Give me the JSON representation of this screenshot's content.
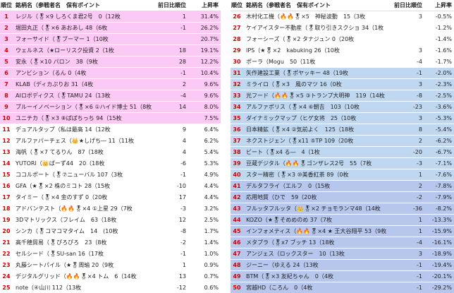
{
  "headers": {
    "rank": "順位",
    "name": "銘柄名（参戦者名　保有ポイント",
    "prev": "前日比順位",
    "rate": "上昇率"
  },
  "left_rows": [
    {
      "rank": "1",
      "name": "レジル（🎖×9 しろくま君2号　0（12枚",
      "prev": "1",
      "rate": "31.4%",
      "bg": "pink"
    },
    {
      "rank": "2",
      "name": "堀田丸正（🎖×6 あおあし 48（6枚",
      "prev": "-1",
      "rate": "26.2%",
      "bg": "pink"
    },
    {
      "rank": "3",
      "name": "フォーサイド（🎖ブーマー 1（10枚",
      "prev": "",
      "rate": "20.7%",
      "bg": "pink"
    },
    {
      "rank": "4",
      "name": "ウェルネス（★ローリスク投資 2（1枚",
      "prev": "18",
      "rate": "19.1%",
      "bg": "pink"
    },
    {
      "rank": "5",
      "name": "安永（🎖×10 パロン　38（9枚",
      "prev": "28",
      "rate": "12.2%",
      "bg": "pink"
    },
    {
      "rank": "6",
      "name": "アンビション（るん 0（4枚",
      "prev": "-1",
      "rate": "10.4%",
      "bg": "pink"
    },
    {
      "rank": "7",
      "name": "KLAB（ディカぷりお 31（4枚",
      "prev": "2",
      "rate": "9.6%",
      "bg": "pink"
    },
    {
      "rank": "8",
      "name": "AIロボディクス（🎖TAMU 24（13枚",
      "prev": "-4",
      "rate": "9.6%",
      "bg": "pink"
    },
    {
      "rank": "9",
      "name": "ブルーイノベーション（🎖×6 ①ハイド博士 51（8枚",
      "prev": "14",
      "rate": "8.0%",
      "bg": "pink"
    },
    {
      "rank": "10",
      "name": "ユニチカ（🎖×3 ⑧ぱぱちっち 94（15枚",
      "prev": "",
      "rate": "7.5%",
      "bg": "pink"
    },
    {
      "rank": "11",
      "name": "デュアルタップ（私は最高 14（12枚",
      "prev": "9",
      "rate": "6.4%",
      "bg": "white"
    },
    {
      "rank": "12",
      "name": "アルファパーチェス（👑★しげち― 11（11枚",
      "prev": "4",
      "rate": "6.2%",
      "bg": "white"
    },
    {
      "rank": "13",
      "name": "海帆（🎖×7 てるりん　87（18枚",
      "prev": "4",
      "rate": "5.4%",
      "bg": "white"
    },
    {
      "rank": "14",
      "name": "YUTORI（👑ぱーず44　20（18枚",
      "prev": "-6",
      "rate": "5.3%",
      "bg": "white"
    },
    {
      "rank": "15",
      "name": "ココルポート（🎖⑦ニューバル 107（3枚",
      "prev": "-1",
      "rate": "4.9%",
      "bg": "white"
    },
    {
      "rank": "16",
      "name": "GFA（★🎖×2 株のミコト 28（15枚",
      "prev": "-10",
      "rate": "4.4%",
      "bg": "white"
    },
    {
      "rank": "17",
      "name": "タイミー（🎖×4 金のすず 0（20枚",
      "prev": "17",
      "rate": "4.4%",
      "bg": "white"
    },
    {
      "rank": "18",
      "name": "アドバンテスト（🔥🔥🎖×4 ①上星 29（7枚",
      "prev": "-3",
      "rate": "3.2%",
      "bg": "white"
    },
    {
      "rank": "19",
      "name": "3Dマトリックス（フレイム　63（18枚",
      "prev": "12",
      "rate": "2.5%",
      "bg": "white"
    },
    {
      "rank": "20",
      "name": "シンカ（🎖コマコマタイム　14　(10枚",
      "prev": "-8",
      "rate": "1.7%",
      "bg": "white"
    },
    {
      "rank": "21",
      "name": "高千穂貿易（🎖ぴろぴろ　23（8枚",
      "prev": "-2",
      "rate": "1.4%",
      "bg": "white"
    },
    {
      "rank": "22",
      "name": "セルシード（🎖SU-san 16（17枚",
      "prev": "-1",
      "rate": "1.0%",
      "bg": "white"
    },
    {
      "rank": "23",
      "name": "丸藤シートパイル（★🎖周瑜 20（9枚",
      "prev": "1",
      "rate": "0.9%",
      "bg": "white"
    },
    {
      "rank": "24",
      "name": "デジタルグリッド（🔥🔥🎖×4 トム　6（14枚",
      "prev": "13",
      "rate": "0.7%",
      "bg": "white"
    },
    {
      "rank": "25",
      "name": "note（④山川 112（13枚",
      "prev": "-12",
      "rate": "0.6%",
      "bg": "white"
    }
  ],
  "right_rows": [
    {
      "rank": "26",
      "name": "木村化工機（🔥🔥🎖×5　神秘波動　15（3枚",
      "prev": "3",
      "rate": "-0.5%",
      "bg": "white"
    },
    {
      "rank": "27",
      "name": "ケイアイスター不動産（🎖取り引きスクショ 34（1枚",
      "prev": "",
      "rate": "-1.2%",
      "bg": "white"
    },
    {
      "rank": "28",
      "name": "フォーシーズ（🎖×2 タナジュン 0（20枚",
      "prev": "",
      "rate": "-1.4%",
      "bg": "white"
    },
    {
      "rank": "29",
      "name": "IPS（★🎖×2　kabuking 26（10枚",
      "prev": "3",
      "rate": "-1.6%",
      "bg": "white"
    },
    {
      "rank": "30",
      "name": "ポーラ（Mogu　50（11枚",
      "prev": "-4",
      "rate": "-1.7%",
      "bg": "white"
    },
    {
      "rank": "31",
      "name": "矢作建設工業（🎖ポヤッキー 48（19枚",
      "prev": "-1",
      "rate": "-2.0%",
      "bg": "blue"
    },
    {
      "rank": "32",
      "name": "ミライロ（🎖×3　風のマツ 16（0枚",
      "prev": "3",
      "rate": "-2.3%",
      "bg": "blue"
    },
    {
      "rank": "33",
      "name": "光フード（🔥🔥🎖×5 ③トランプ大明神　119（14枚",
      "prev": "-8",
      "rate": "-2.5%",
      "bg": "blue"
    },
    {
      "rank": "34",
      "name": "アルファポリス（🎖×4 ⑥朝吉　103（10枚",
      "prev": "-23",
      "rate": "-3.6%",
      "bg": "blue"
    },
    {
      "rank": "35",
      "name": "ダイナミックマップ（ヒゲ女将　25（10枚",
      "prev": "3",
      "rate": "-5.3%",
      "bg": "blue"
    },
    {
      "rank": "36",
      "name": "日本精鉱（🎖×4 ②気前よく　125（18枚",
      "prev": "8",
      "rate": "-5.4%",
      "bg": "blue"
    },
    {
      "rank": "37",
      "name": "ネクストジェン（🎖x11 ⑤TP 109（20枚",
      "prev": "2",
      "rate": "-6.2%",
      "bg": "blue"
    },
    {
      "rank": "38",
      "name": "ビート（🎖x4 る―　4（1枚",
      "prev": "-20",
      "rate": "-6.7%",
      "bg": "blue"
    },
    {
      "rank": "39",
      "name": "豆蔵デジタル（🔥🔥🎖ゴンザレス2号　55（7枚",
      "prev": "-3",
      "rate": "-7.1%",
      "bg": "blue"
    },
    {
      "rank": "40",
      "name": "スター精密（🎖×3 ⑩美香紅茶 89（0枚",
      "prev": "1",
      "rate": "-7.6%",
      "bg": "blue"
    },
    {
      "rank": "41",
      "name": "デルタフライ（エルフ　0（15枚",
      "prev": "2",
      "rate": "-7.8%",
      "bg": "periwinkle"
    },
    {
      "rank": "42",
      "name": "応用地質（ひで　59（20枚",
      "prev": "-2",
      "rate": "-7.9%",
      "bg": "periwinkle"
    },
    {
      "rank": "43",
      "name": "フルッタフルッタ（👑🎖×2 チョモランマ48（14枚",
      "prev": "-36",
      "rate": "-8.2%",
      "bg": "periwinkle"
    },
    {
      "rank": "44",
      "name": "KOZO（★🎖そめめのめ 37（7枚",
      "prev": "1",
      "rate": "-13.3%",
      "bg": "periwinkle"
    },
    {
      "rank": "45",
      "name": "インフォメティス（🔥🔥🎖×4 ★ 王大谷翔平 53（9枚",
      "prev": "1",
      "rate": "-15.9%",
      "bg": "periwinkle"
    },
    {
      "rank": "46",
      "name": "メタプラ（🎖x7 ブッチ 13（18枚",
      "prev": "-4",
      "rate": "-16.1%",
      "bg": "periwinkle"
    },
    {
      "rank": "47",
      "name": "アンジェス（ロックスター　10（13枚",
      "prev": "3",
      "rate": "-18.9%",
      "bg": "periwinkle"
    },
    {
      "rank": "48",
      "name": "ジーニー（ゆえる 24（13枚",
      "prev": "-1",
      "rate": "-19.4%",
      "bg": "periwinkle"
    },
    {
      "rank": "49",
      "name": "BTM（🎖×3 友紀ちゃん　0（4枚",
      "prev": "-1",
      "rate": "-20.1%",
      "bg": "periwinkle"
    },
    {
      "rank": "50",
      "name": "宮越HD（ころん　0（4枚",
      "prev": "-1",
      "rate": "-29.2%",
      "bg": "periwinkle"
    }
  ]
}
